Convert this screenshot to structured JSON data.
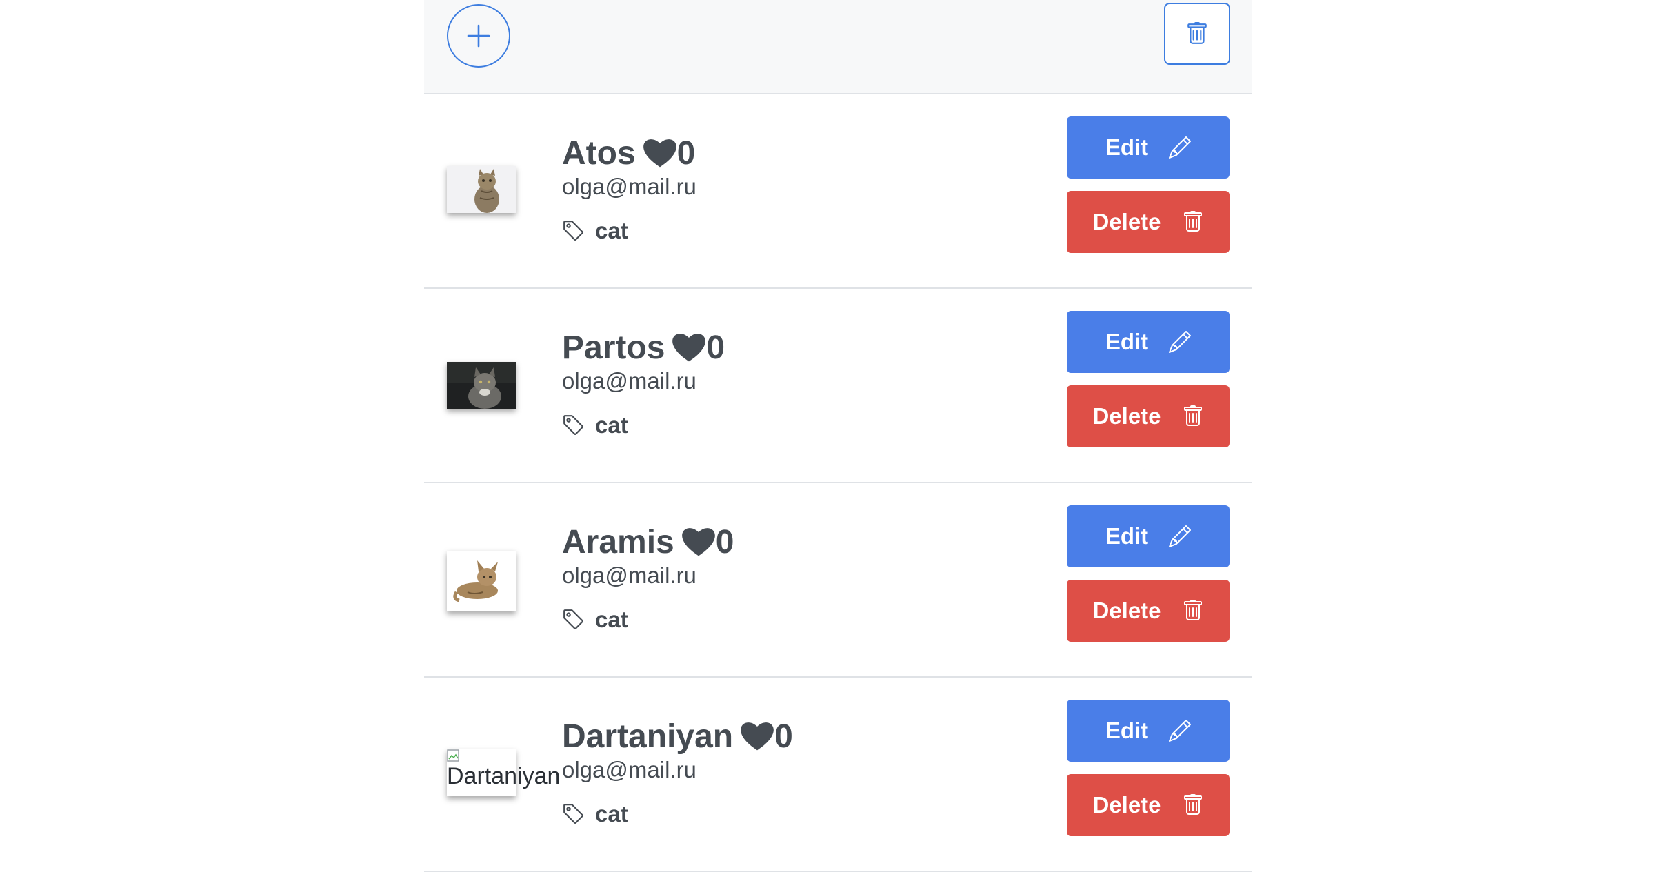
{
  "toolbar": {
    "add_icon": "plus-icon",
    "delete_all_icon": "trash-icon"
  },
  "items": [
    {
      "name": "Atos",
      "likes": "0",
      "email": "olga@mail.ru",
      "tag": "cat",
      "image": "cat-photo-light",
      "edit_label": "Edit",
      "delete_label": "Delete"
    },
    {
      "name": "Partos",
      "likes": "0",
      "email": "olga@mail.ru",
      "tag": "cat",
      "image": "cat-photo-dark",
      "edit_label": "Edit",
      "delete_label": "Delete"
    },
    {
      "name": "Aramis",
      "likes": "0",
      "email": "olga@mail.ru",
      "tag": "cat",
      "image": "cat-photo-white",
      "edit_label": "Edit",
      "delete_label": "Delete"
    },
    {
      "name": "Dartaniyan",
      "likes": "0",
      "email": "olga@mail.ru",
      "tag": "cat",
      "image_alt": "Dartaniyan",
      "edit_label": "Edit",
      "delete_label": "Delete"
    }
  ],
  "colors": {
    "primary": "#4a7ee8",
    "danger": "#de4f47",
    "outline": "#3d7de0",
    "text": "#454b52",
    "toolbar_bg": "#f7f8f9",
    "divider": "#dfe2e6"
  }
}
